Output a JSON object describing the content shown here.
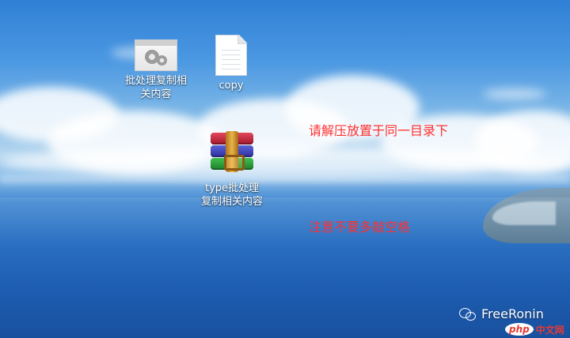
{
  "desktop": {
    "icons": [
      {
        "name": "batch-file-icon",
        "label": "批处理复制相\n关内容"
      },
      {
        "name": "text-file-icon",
        "label": "copy"
      },
      {
        "name": "winrar-archive-icon",
        "label": "type批处理\n复制相关内容"
      }
    ],
    "annotations": [
      "请解压放置于同一目录下",
      "注意不要多敲空格"
    ]
  },
  "watermark": {
    "icon": "wechat-icon",
    "text": "FreeRonin"
  },
  "site_badge": {
    "php": "php",
    "cn": "中文网"
  },
  "colors": {
    "annotation": "#ff3030",
    "label_text": "#ffffff"
  }
}
